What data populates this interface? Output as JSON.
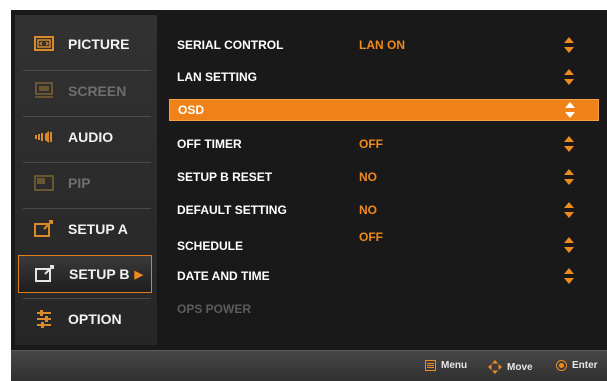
{
  "categories": [
    {
      "label": "PICTURE",
      "icon": "picture-icon",
      "state": "normal"
    },
    {
      "label": "SCREEN",
      "icon": "screen-icon",
      "state": "disabled"
    },
    {
      "label": "AUDIO",
      "icon": "audio-icon",
      "state": "normal"
    },
    {
      "label": "PIP",
      "icon": "pip-icon",
      "state": "disabled"
    },
    {
      "label": "SETUP A",
      "icon": "setup-a-icon",
      "state": "normal"
    },
    {
      "label": "SETUP B",
      "icon": "setup-b-icon",
      "state": "active"
    },
    {
      "label": "OPTION",
      "icon": "option-icon",
      "state": "normal"
    }
  ],
  "active_arrow": "▶",
  "items": [
    {
      "label": "SERIAL CONTROL",
      "value": "LAN ON",
      "adjustable": true,
      "selected": false,
      "enabled": true
    },
    {
      "label": "LAN SETTING",
      "value": "",
      "adjustable": true,
      "selected": false,
      "enabled": true
    },
    {
      "label": "OSD",
      "value": "",
      "adjustable": true,
      "selected": true,
      "enabled": true
    },
    {
      "label": "OFF TIMER",
      "value": "OFF",
      "adjustable": true,
      "selected": false,
      "enabled": true
    },
    {
      "label": "SETUP B RESET",
      "value": "NO",
      "adjustable": true,
      "selected": false,
      "enabled": true
    },
    {
      "label": "DEFAULT SETTING",
      "value": "NO",
      "adjustable": true,
      "selected": false,
      "enabled": true
    },
    {
      "label": "SCHEDULE",
      "value": "OFF",
      "adjustable": true,
      "selected": false,
      "enabled": true
    },
    {
      "label": "DATE AND TIME",
      "value": "",
      "adjustable": true,
      "selected": false,
      "enabled": true
    },
    {
      "label": "OPS POWER",
      "value": "",
      "adjustable": false,
      "selected": false,
      "enabled": false
    }
  ],
  "footer": {
    "menu": "Menu",
    "move": "Move",
    "enter": "Enter"
  },
  "colors": {
    "accent": "#EE8118",
    "background": "#191919",
    "text": "#FFFFFF",
    "disabled": "#5C5C5C"
  }
}
